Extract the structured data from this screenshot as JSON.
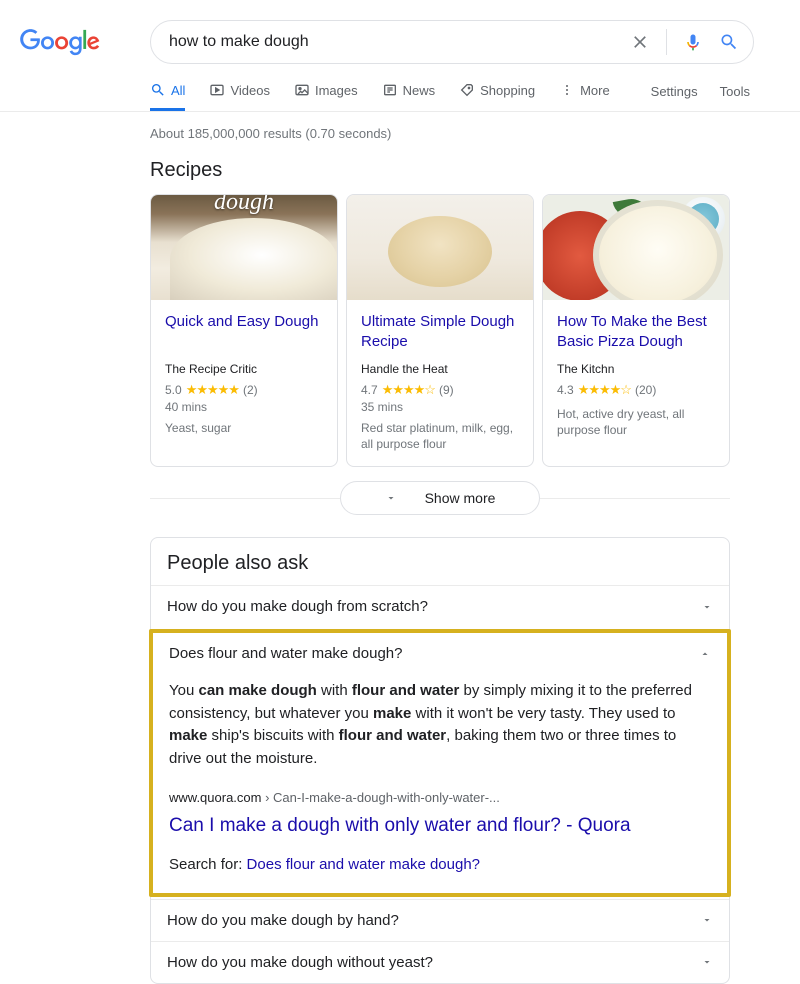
{
  "search": {
    "query": "how to make dough"
  },
  "tabs": [
    "All",
    "Videos",
    "Images",
    "News",
    "Shopping",
    "More"
  ],
  "nav_right": [
    "Settings",
    "Tools"
  ],
  "result_stats": "About 185,000,000 results (0.70 seconds)",
  "recipes_title": "Recipes",
  "recipes": [
    {
      "img_script": "dough",
      "title": "Quick and Easy Dough",
      "source": "The Recipe Critic",
      "rating": "5.0",
      "stars": "★★★★★",
      "count": "(2)",
      "time": "40 mins",
      "ing": "Yeast, sugar"
    },
    {
      "title": "Ultimate Simple Dough Recipe",
      "source": "Handle the Heat",
      "rating": "4.7",
      "stars": "★★★★☆",
      "count": "(9)",
      "time": "35 mins",
      "ing": "Red star platinum, milk, egg, all purpose flour"
    },
    {
      "title": "How To Make the Best Basic Pizza Dough",
      "source": "The Kitchn",
      "rating": "4.3",
      "stars": "★★★★☆",
      "count": "(20)",
      "time": "",
      "ing": "Hot, active dry yeast, all purpose flour"
    }
  ],
  "show_more": "Show more",
  "paa_title": "People also ask",
  "paa_questions": [
    {
      "q": "How do you make dough from scratch?"
    },
    {
      "q": "Does flour and water make dough?",
      "expanded": true,
      "answer_html": "You <b>can make dough</b> with <b>flour and water</b> by simply mixing it to the preferred consistency, but whatever you <b>make</b> with it won't be very tasty. They used to <b>make</b> ship's biscuits with <b>flour and water</b>, baking them two or three times to drive out the moisture.",
      "cite_domain": "www.quora.com",
      "cite_crumb": " › Can-I-make-a-dough-with-only-water-...",
      "link_title": "Can I make a dough with only water and flour? - Quora",
      "search_for_label": "Search for: ",
      "search_for_link": "Does flour and water make dough?"
    },
    {
      "q": "How do you make dough by hand?"
    },
    {
      "q": "How do you make dough without yeast?"
    }
  ]
}
